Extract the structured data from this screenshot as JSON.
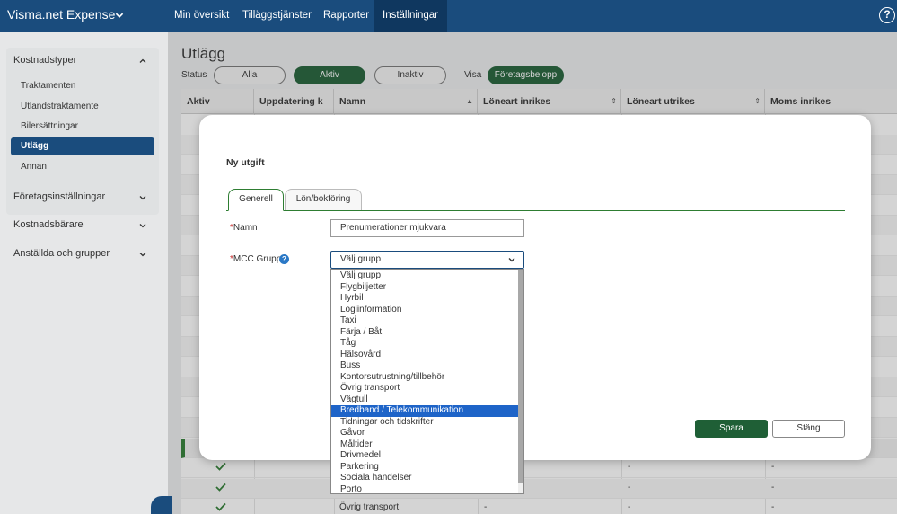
{
  "app": {
    "title": "Visma.net Expense"
  },
  "topnav": [
    "Min översikt",
    "Tilläggstjänster",
    "Rapporter",
    "Inställningar"
  ],
  "sidebar": {
    "section": "Kostnadstyper",
    "items": [
      "Traktamenten",
      "Utlandstraktamente",
      "Bilersättningar",
      "Utlägg",
      "Annan"
    ],
    "active_item": "Utlägg",
    "groups": [
      "Företagsinställningar",
      "Kostnadsbärare",
      "Anställda och grupper"
    ]
  },
  "page": {
    "title": "Utlägg",
    "status_label": "Status",
    "status_options": [
      "Alla",
      "Aktiv",
      "Inaktiv"
    ],
    "status_selected": "Aktiv",
    "show_label": "Visa",
    "show_option": "Företagsbelopp"
  },
  "table": {
    "columns": [
      "Aktiv",
      "Uppdatering k",
      "Namn",
      "Löneart inrikes",
      "Löneart utrikes",
      "Moms inrikes"
    ],
    "visible_rows": [
      {
        "active": true,
        "name": "",
        "wage_domestic": "",
        "wage_foreign": "-",
        "vat_domestic": "-"
      },
      {
        "active": true,
        "name": "",
        "wage_domestic": "",
        "wage_foreign": "-",
        "vat_domestic": "-"
      },
      {
        "active": true,
        "name": "Övrig transport",
        "wage_domestic": "-",
        "wage_foreign": "-",
        "vat_domestic": "-"
      }
    ]
  },
  "modal": {
    "title": "Ny utgift",
    "tabs": [
      "Generell",
      "Lön/bokföring"
    ],
    "active_tab": "Generell",
    "name_label": "Namn",
    "name_value": "Prenumerationer mjukvara",
    "mcc_label": "MCC Grupp",
    "required_mark": "*",
    "info_icon": "?",
    "select_value": "Välj grupp",
    "options": [
      "Välj grupp",
      "Flygbiljetter",
      "Hyrbil",
      "Logiinformation",
      "Taxi",
      "Färja / Båt",
      "Tåg",
      "Hälsovård",
      "Buss",
      "Kontorsutrustning/tillbehör",
      "Övrig transport",
      "Vägtull",
      "Bredband / Telekommunikation",
      "Tidningar och tidskrifter",
      "Gåvor",
      "Måltider",
      "Drivmedel",
      "Parkering",
      "Sociala händelser",
      "Porto"
    ],
    "highlighted_option": "Bredband / Telekommunikation",
    "save_label": "Spara",
    "close_label": "Stäng"
  },
  "colors": {
    "topbar": "#1a4c7d",
    "accent_green": "#1f5f36",
    "selection_blue": "#1e64c8"
  },
  "icons": [
    "chevron-down-icon",
    "chevron-up-icon",
    "help-icon",
    "sort-icon",
    "check-icon",
    "info-icon",
    "collapse-icon"
  ]
}
